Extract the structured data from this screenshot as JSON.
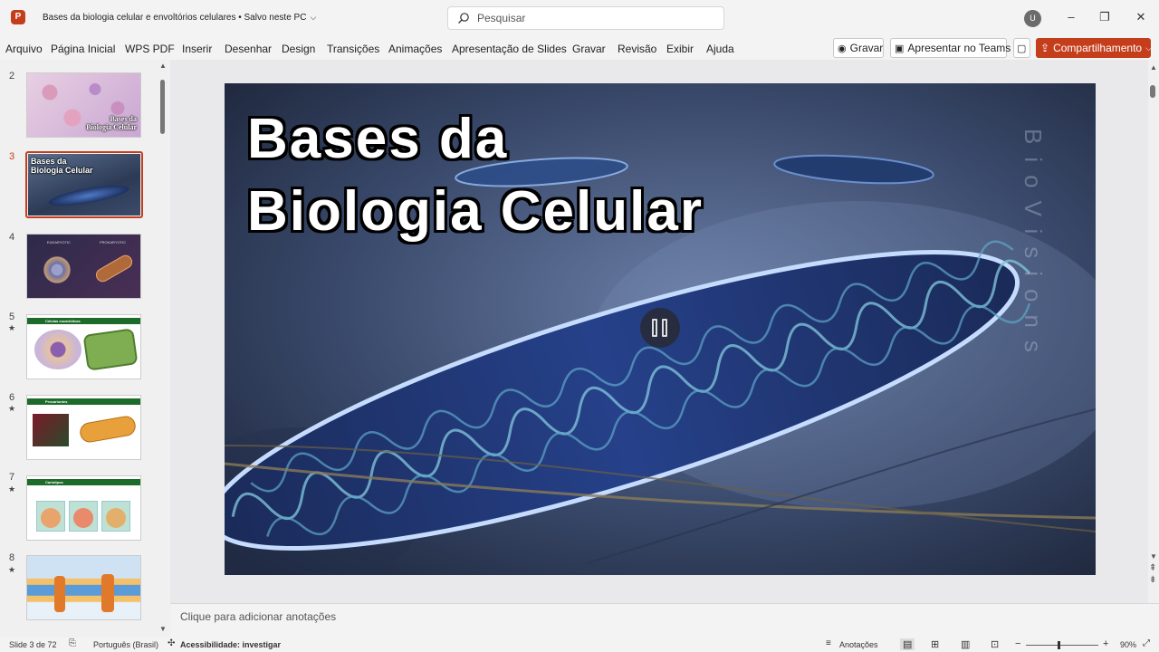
{
  "app": {
    "logo_letter": "P",
    "title": "Bases da biologia celular e envoltórios celulares • Salvo neste PC",
    "search_placeholder": "Pesquisar",
    "avatar_initial": "U"
  },
  "ribbon": {
    "tabs": [
      "Arquivo",
      "Página Inicial",
      "WPS PDF",
      "Inserir",
      "Desenhar",
      "Design",
      "Transições",
      "Animações",
      "Apresentação de Slides",
      "Gravar",
      "Revisão",
      "Exibir",
      "Ajuda"
    ],
    "record_label": "Gravar",
    "teams_label": "Apresentar no Teams",
    "share_label": "Compartilhamento"
  },
  "slides_panel": {
    "items": [
      {
        "num": "2",
        "starred": false,
        "title_lines": [
          "Bases da",
          "Biologia Celular"
        ]
      },
      {
        "num": "3",
        "starred": false,
        "active": true,
        "title_lines": [
          "Bases da",
          "Biologia Celular"
        ]
      },
      {
        "num": "4",
        "starred": false,
        "labels": [
          "EUKARYOTIC",
          "PROKARYOTIC"
        ]
      },
      {
        "num": "5",
        "starred": true,
        "header": "Células eucarióticas"
      },
      {
        "num": "6",
        "starred": true,
        "header": "Procariontes"
      },
      {
        "num": "7",
        "starred": true,
        "header": "Cariotipos"
      },
      {
        "num": "8",
        "starred": true
      }
    ]
  },
  "slide": {
    "title_line1": "Bases da",
    "title_line2": "Biologia Celular",
    "watermark": "BioVisions"
  },
  "notes": {
    "placeholder": "Clique para adicionar anotações"
  },
  "status": {
    "slide_count": "Slide 3 de 72",
    "language": "Português (Brasil)",
    "accessibility": "Acessibilidade: investigar",
    "notes_label": "Anotações",
    "zoom": "90%"
  },
  "colors": {
    "accent": "#c43e1c",
    "ribbon_bg": "#f3f3f3",
    "slide_bg": "#2a3650"
  }
}
